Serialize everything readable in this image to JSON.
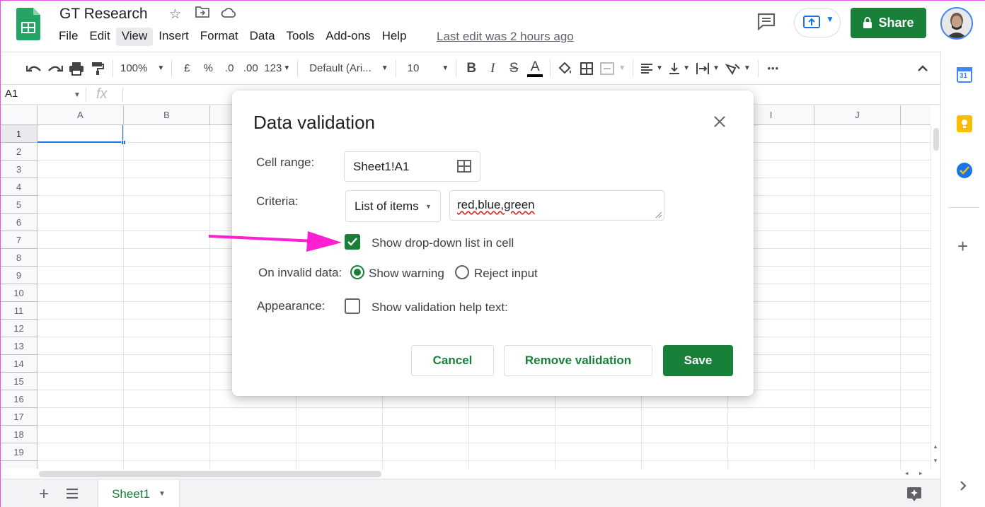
{
  "app": {
    "doc_title": "GT Research",
    "menus": [
      "File",
      "Edit",
      "View",
      "Insert",
      "Format",
      "Data",
      "Tools",
      "Add-ons",
      "Help"
    ],
    "active_menu": "View",
    "last_edit": "Last edit was 2 hours ago",
    "share_label": "Share"
  },
  "toolbar": {
    "zoom": "100%",
    "currency": "£",
    "percent": "%",
    "dec_decrease": ".0",
    "dec_increase": ".00",
    "more_formats": "123",
    "font": "Default (Ari...",
    "font_size": "10",
    "bold": "B",
    "italic": "I",
    "strike": "S",
    "text_color": "A",
    "more": "•••"
  },
  "formula_bar": {
    "name_box": "A1",
    "fx": "fx"
  },
  "grid": {
    "columns": [
      "A",
      "B",
      "",
      "",
      "",
      "",
      "",
      "",
      "I",
      "J"
    ],
    "rows": [
      "1",
      "2",
      "3",
      "4",
      "5",
      "6",
      "7",
      "8",
      "9",
      "10",
      "11",
      "12",
      "13",
      "14",
      "15",
      "16",
      "17",
      "18",
      "19"
    ]
  },
  "sheets": {
    "active": "Sheet1"
  },
  "sidebar": {
    "calendar_day": "31"
  },
  "dialog": {
    "title": "Data validation",
    "cell_range_label": "Cell range:",
    "cell_range_value": "Sheet1!A1",
    "criteria_label": "Criteria:",
    "criteria_type": "List of items",
    "criteria_value": "red,blue,green",
    "show_dropdown_label": "Show drop-down list in cell",
    "show_dropdown_checked": true,
    "invalid_label": "On invalid data:",
    "invalid_options": [
      "Show warning",
      "Reject input"
    ],
    "invalid_selected": "Show warning",
    "appearance_label": "Appearance:",
    "help_text_label": "Show validation help text:",
    "help_text_checked": false,
    "cancel_label": "Cancel",
    "remove_label": "Remove validation",
    "save_label": "Save"
  },
  "colors": {
    "brand_green": "#188038",
    "selection_blue": "#1a73e8",
    "annotation_arrow": "#ff1fd2"
  }
}
